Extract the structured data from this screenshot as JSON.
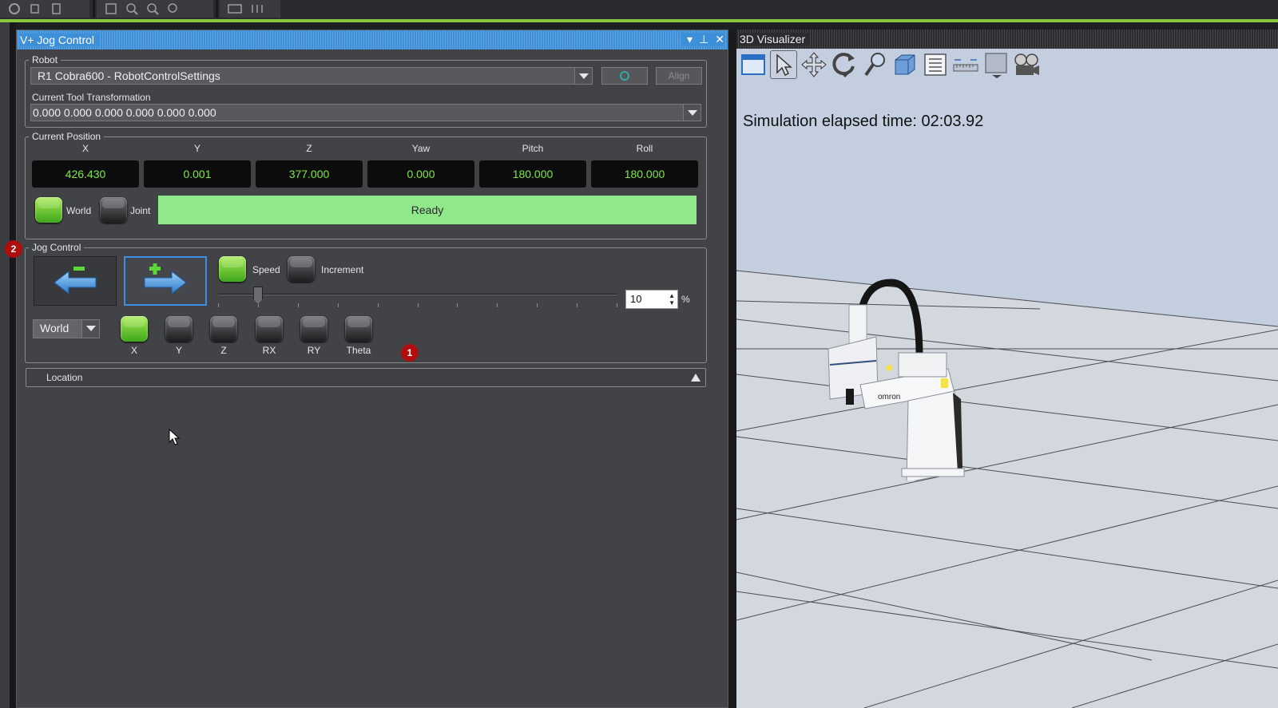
{
  "toolbar": {
    "icons": [
      "refresh-icon",
      "copy-icon",
      "paste-icon",
      "frame-icon",
      "zoom-in-icon",
      "zoom-out-icon",
      "zoom-fit-icon",
      "grid-icon",
      "module-icon"
    ]
  },
  "jog_panel": {
    "title": "V+ Jog Control",
    "robot": {
      "legend": "Robot",
      "selected": "R1 Cobra600  -  RobotControlSettings",
      "power_button_color": "#3aa6a6",
      "align_label": "Align",
      "tool_label": "Current Tool Transformation",
      "tool_value": "0.000 0.000 0.000 0.000 0.000 0.000"
    },
    "position": {
      "legend": "Current Position",
      "columns": [
        {
          "label": "X",
          "value": "426.430"
        },
        {
          "label": "Y",
          "value": "0.001"
        },
        {
          "label": "Z",
          "value": "377.000"
        },
        {
          "label": "Yaw",
          "value": "0.000"
        },
        {
          "label": "Pitch",
          "value": "180.000"
        },
        {
          "label": "Roll",
          "value": "180.000"
        }
      ],
      "world_label": "World",
      "joint_label": "Joint",
      "status": "Ready"
    },
    "jog": {
      "legend": "Jog Control",
      "speed_label": "Speed",
      "increment_label": "Increment",
      "slider_value": 10,
      "spin_value": "10",
      "percent": "%",
      "frame_selected": "World",
      "axes": [
        "X",
        "Y",
        "Z",
        "RX",
        "RY",
        "Theta"
      ],
      "active_axis": "X"
    },
    "location_label": "Location"
  },
  "markers": {
    "one": "1",
    "two": "2"
  },
  "visualizer": {
    "title": "3D Visualizer",
    "sim_time": "Simulation elapsed time: 02:03.92",
    "robot_brand": "omron"
  },
  "colors": {
    "accent": "#3d8fd8",
    "ready": "#8fe88a",
    "value_green": "#7cea3c",
    "marker": "#b00d0d"
  }
}
